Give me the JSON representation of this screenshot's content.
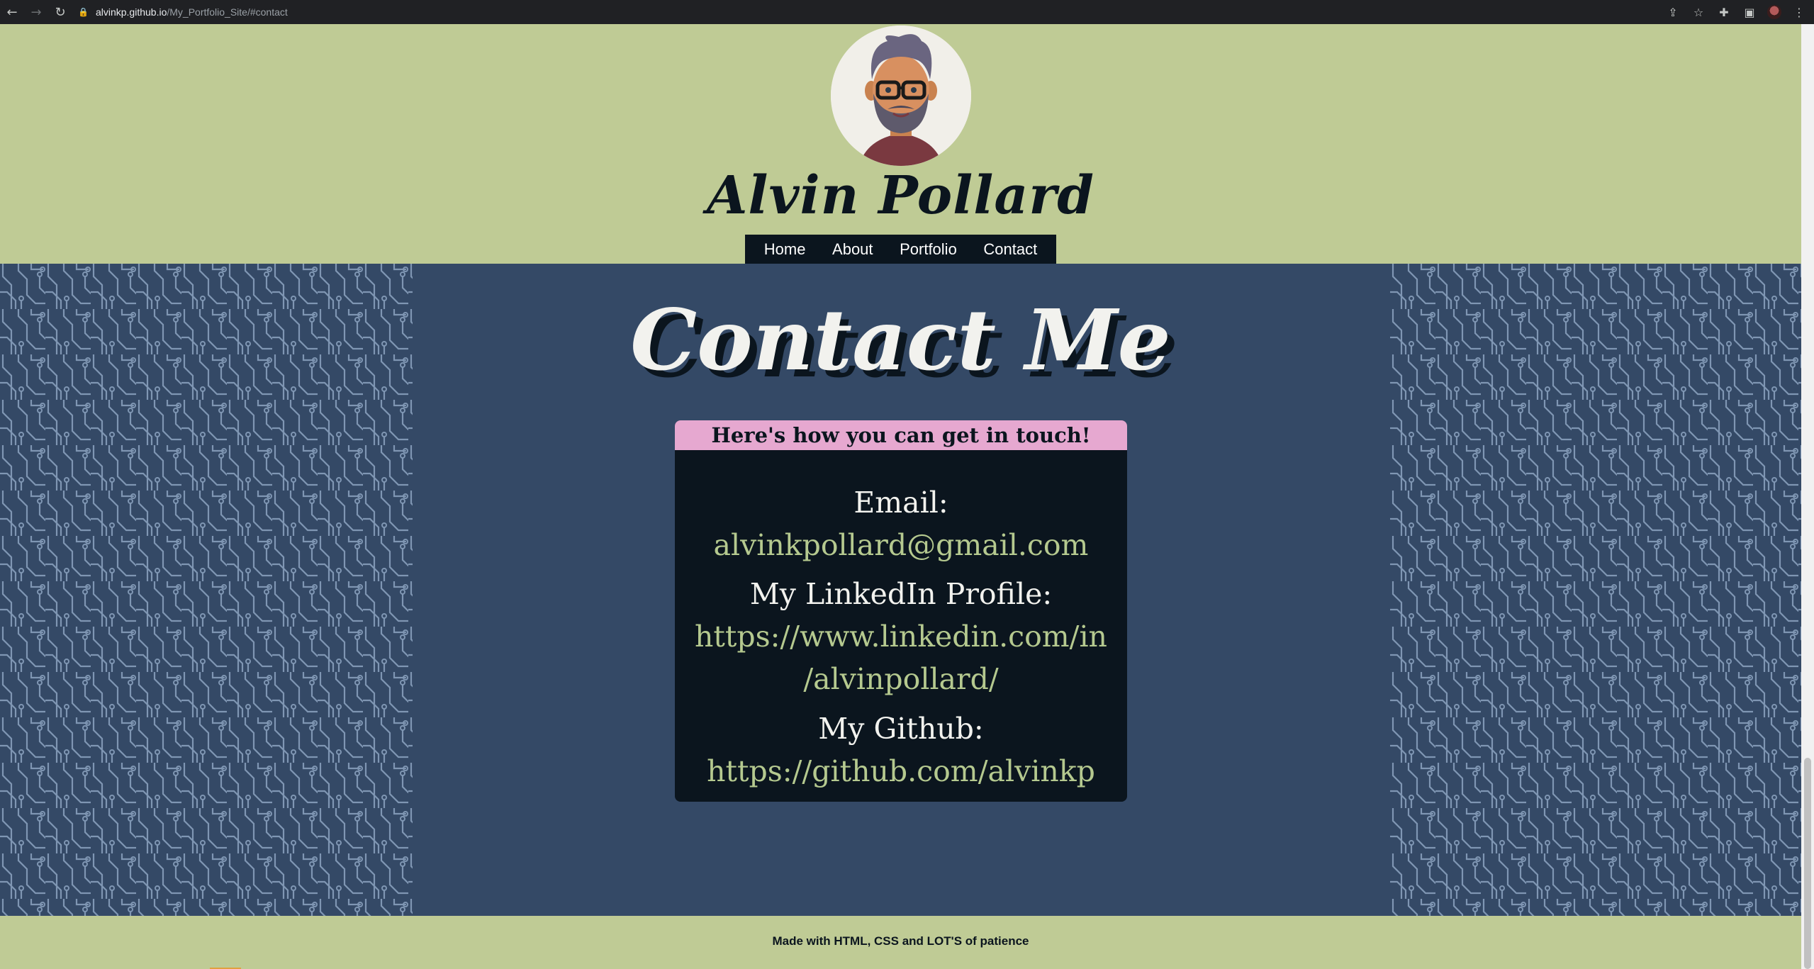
{
  "browser": {
    "url_host": "alvinkp.github.io",
    "url_path": "/My_Portfolio_Site/#contact",
    "back_icon": "←",
    "forward_icon": "→",
    "reload_icon": "↻",
    "lock_icon": "🔒",
    "share_icon": "⇪",
    "star_icon": "☆",
    "extensions_icon": "✚",
    "sidepanel_icon": "▣",
    "menu_icon": "⋮"
  },
  "header": {
    "site_title": "Alvin Pollard",
    "nav": [
      "Home",
      "About",
      "Portfolio",
      "Contact"
    ]
  },
  "contact": {
    "heading": "Contact Me",
    "card_title": "Here's how you can get in touch!",
    "email_label": "Email:",
    "email_value": "alvinkpollard@gmail.com",
    "linkedin_label": "My LinkedIn Profile:",
    "linkedin_line1": "https://www.linkedin.com/in",
    "linkedin_line2": "/alvinpollard/",
    "github_label": "My Github:",
    "github_value": "https://github.com/alvinkp"
  },
  "footer": {
    "text": "Made with HTML, CSS and LOT'S of patience"
  },
  "colors": {
    "header_bg": "#bfcb95",
    "main_bg": "#344966",
    "dark": "#0b151e",
    "card_head": "#e6a8d0",
    "link": "#b5c98f",
    "light_text": "#f2f2ee"
  }
}
